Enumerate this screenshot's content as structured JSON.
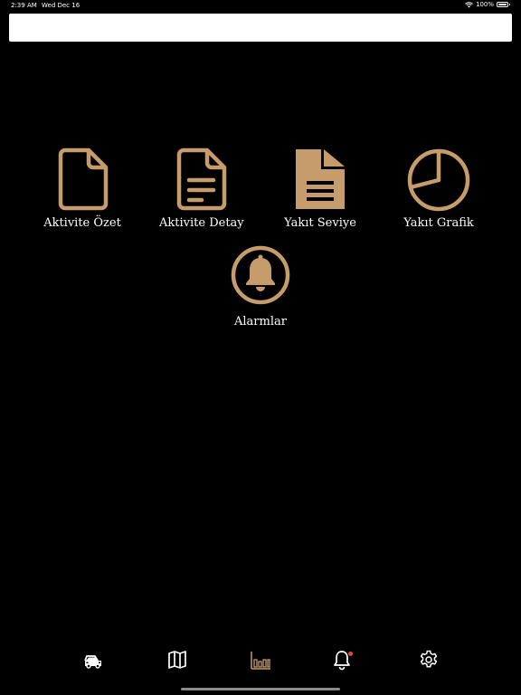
{
  "status_bar": {
    "time": "2:39 AM",
    "date": "Wed Dec 16",
    "battery": "100%"
  },
  "search": {
    "value": "",
    "placeholder": ""
  },
  "menu": {
    "items": [
      {
        "label": "Aktivite Özet",
        "icon": "document-icon"
      },
      {
        "label": "Aktivite Detay",
        "icon": "document-text-icon"
      },
      {
        "label": "Yakıt Seviye",
        "icon": "document-filled-icon"
      },
      {
        "label": "Yakıt Grafik",
        "icon": "pie-chart-icon"
      },
      {
        "label": "Alarmlar",
        "icon": "bell-circle-icon"
      }
    ]
  },
  "tabbar": {
    "items": [
      {
        "name": "vehicles",
        "icon": "car-icon",
        "active": false
      },
      {
        "name": "map",
        "icon": "map-icon",
        "active": false
      },
      {
        "name": "reports",
        "icon": "bar-chart-icon",
        "active": true
      },
      {
        "name": "alarms",
        "icon": "bell-icon",
        "active": false,
        "badge_dot": true
      },
      {
        "name": "settings",
        "icon": "gear-icon",
        "active": false
      }
    ]
  },
  "colors": {
    "background": "#000000",
    "accent": "#c69c6d",
    "text": "#ffffff",
    "badge": "#e5483b",
    "search_bg": "#ffffff"
  }
}
